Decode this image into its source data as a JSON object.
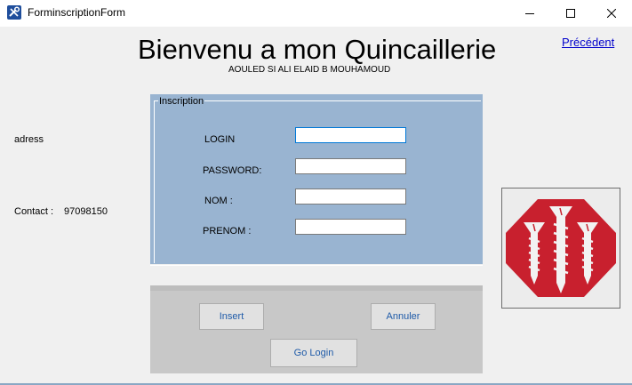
{
  "window": {
    "title": "ForminscriptionForm",
    "icons": {
      "app": "tools-icon",
      "minimize": "minimize-icon",
      "maximize": "maximize-icon",
      "close": "close-icon"
    }
  },
  "header": {
    "title": "Bienvenu a mon Quincaillerie",
    "subtitle": "AOULED SI ALI ELAID B MOUHAMOUD",
    "prev_link": "Précédent"
  },
  "side": {
    "address_label": "adress",
    "contact_label": "Contact :",
    "contact_value": "97098150"
  },
  "form": {
    "group_title": "Inscription",
    "fields": [
      {
        "label": "LOGIN",
        "value": ""
      },
      {
        "label": "PASSWORD:",
        "value": ""
      },
      {
        "label": "NOM :",
        "value": ""
      },
      {
        "label": "PRENOM :",
        "value": ""
      }
    ]
  },
  "actions": {
    "insert": "Insert",
    "cancel": "Annuler",
    "go_login": "Go Login"
  },
  "logo": {
    "icon": "screws-logo-icon"
  },
  "colors": {
    "form_panel": "#99b4d1",
    "button_panel": "#c8c8c8",
    "button_text": "#1e5aa8",
    "link": "#0000cc",
    "logo_red": "#c8202e",
    "focus_border": "#0078d7"
  }
}
